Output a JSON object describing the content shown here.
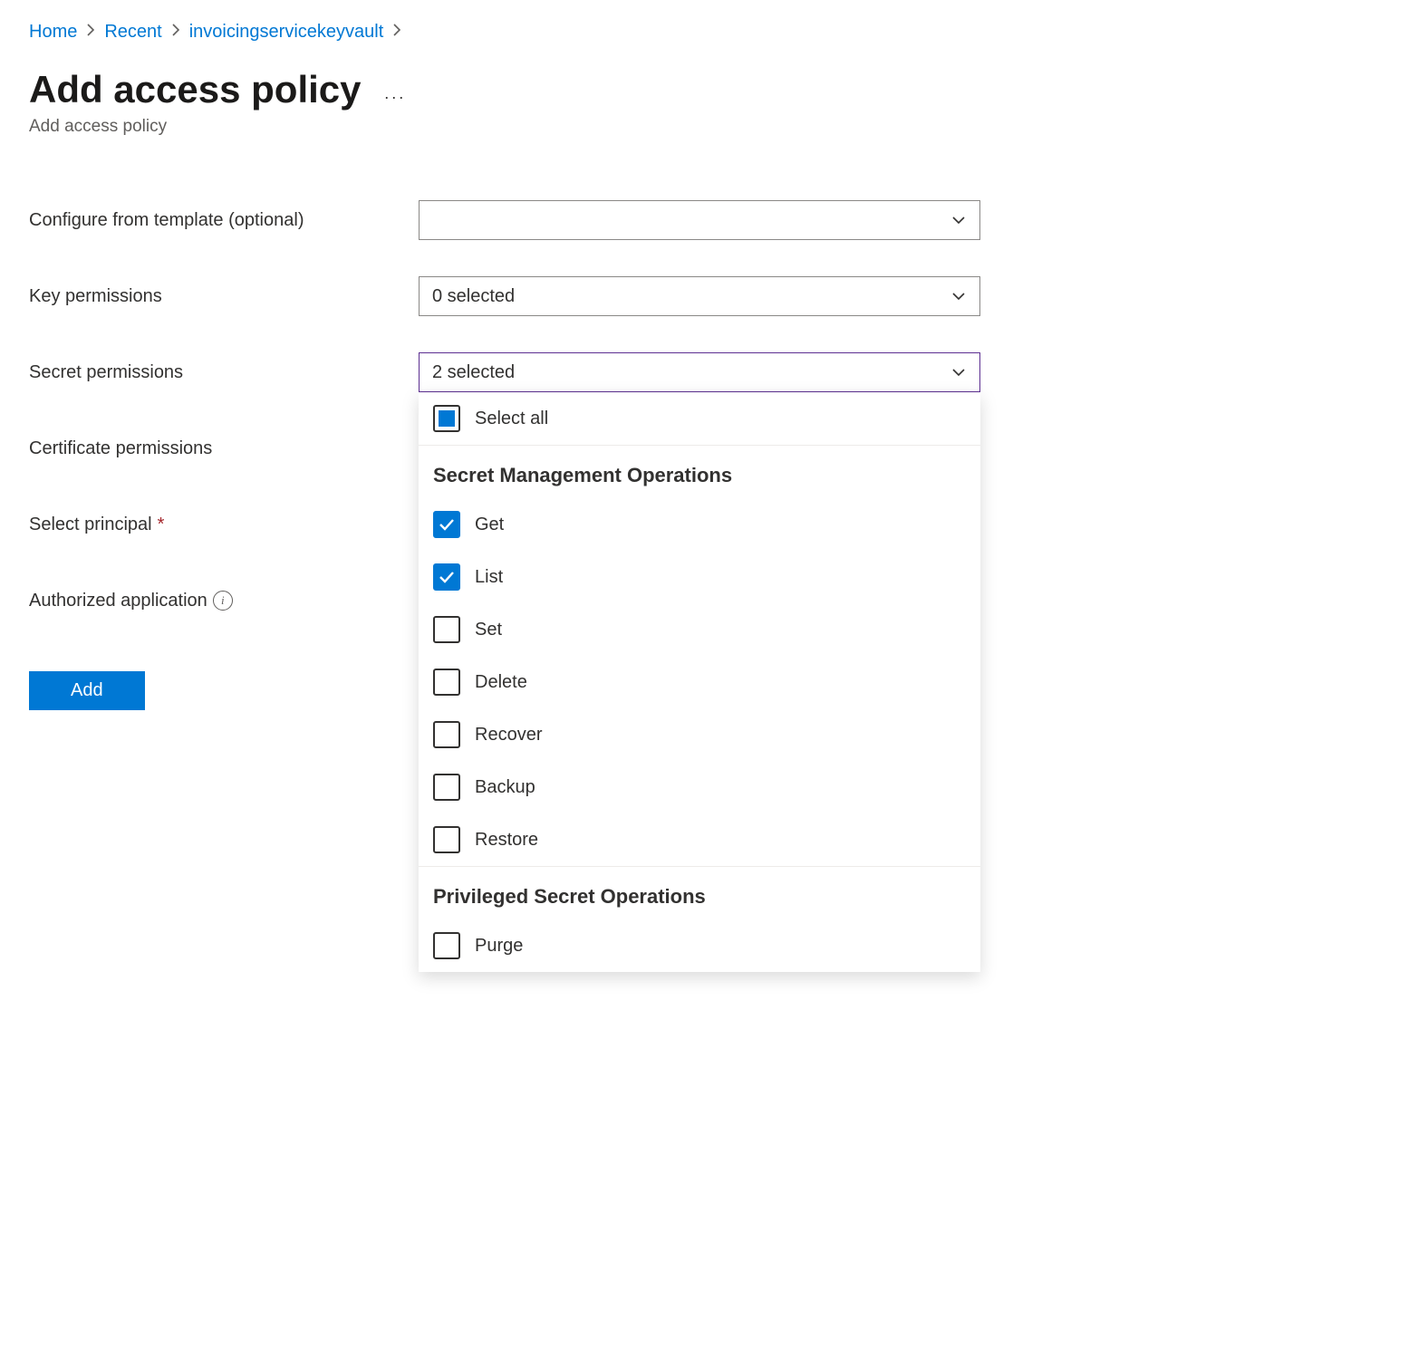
{
  "breadcrumb": {
    "items": [
      {
        "label": "Home"
      },
      {
        "label": "Recent"
      },
      {
        "label": "invoicingservicekeyvault"
      }
    ]
  },
  "header": {
    "title": "Add access policy",
    "subtitle": "Add access policy"
  },
  "form": {
    "template_label": "Configure from template (optional)",
    "template_value": "",
    "key_label": "Key permissions",
    "key_value": "0 selected",
    "secret_label": "Secret permissions",
    "secret_value": "2 selected",
    "cert_label": "Certificate permissions",
    "principal_label": "Select principal",
    "authapp_label": "Authorized application",
    "add_button": "Add"
  },
  "dropdown": {
    "select_all_label": "Select all",
    "groups": [
      {
        "title": "Secret Management Operations",
        "options": [
          {
            "label": "Get",
            "checked": true
          },
          {
            "label": "List",
            "checked": true
          },
          {
            "label": "Set",
            "checked": false
          },
          {
            "label": "Delete",
            "checked": false
          },
          {
            "label": "Recover",
            "checked": false
          },
          {
            "label": "Backup",
            "checked": false
          },
          {
            "label": "Restore",
            "checked": false
          }
        ]
      },
      {
        "title": "Privileged Secret Operations",
        "options": [
          {
            "label": "Purge",
            "checked": false
          }
        ]
      }
    ]
  }
}
